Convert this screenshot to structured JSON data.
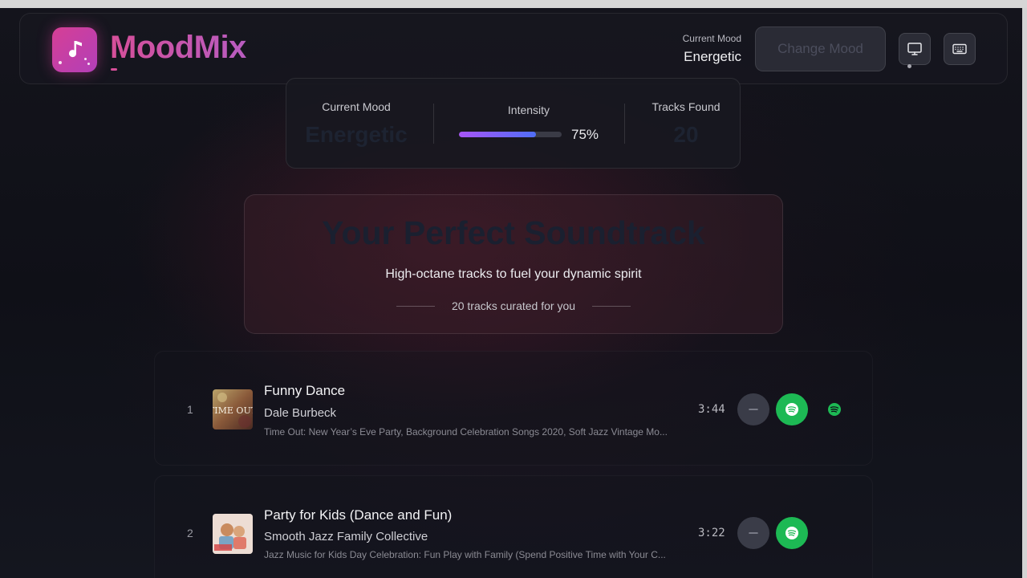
{
  "app": {
    "name": "MoodMix"
  },
  "header": {
    "current_mood_label": "Current Mood",
    "current_mood_value": "Energetic",
    "change_mood_label": "Change Mood",
    "icons": [
      "music-note-icon",
      "monitor-icon",
      "keyboard-icon"
    ]
  },
  "stats": {
    "mood_label": "Current Mood",
    "mood_value": "Energetic",
    "intensity_label": "Intensity",
    "intensity_percent": "75%",
    "intensity_fraction": 0.75,
    "tracks_label": "Tracks Found",
    "tracks_value": "20"
  },
  "hero": {
    "title": "Your Perfect Soundtrack",
    "subtitle": "High-octane tracks to fuel your dynamic spirit",
    "count_text": "20 tracks curated for you"
  },
  "tracks": [
    {
      "number": "1",
      "title": "Funny Dance",
      "artist": "Dale Burbeck",
      "album": "Time Out: New Year’s Eve Party, Background Celebration Songs 2020, Soft Jazz Vintage Mo...",
      "duration": "3:44",
      "cover_text": "TIME OUT"
    },
    {
      "number": "2",
      "title": "Party for Kids (Dance and Fun)",
      "artist": "Smooth Jazz Family Collective",
      "album": "Jazz Music for Kids Day Celebration: Fun Play with Family (Spend Positive Time with Your C...",
      "duration": "3:22",
      "cover_text": ""
    }
  ],
  "colors": {
    "brand_pink": "#d64f99",
    "brand_purple": "#b23fb8",
    "spotify_green": "#1db954",
    "intensity_start": "#a855f7",
    "intensity_end": "#4f6ef7"
  }
}
